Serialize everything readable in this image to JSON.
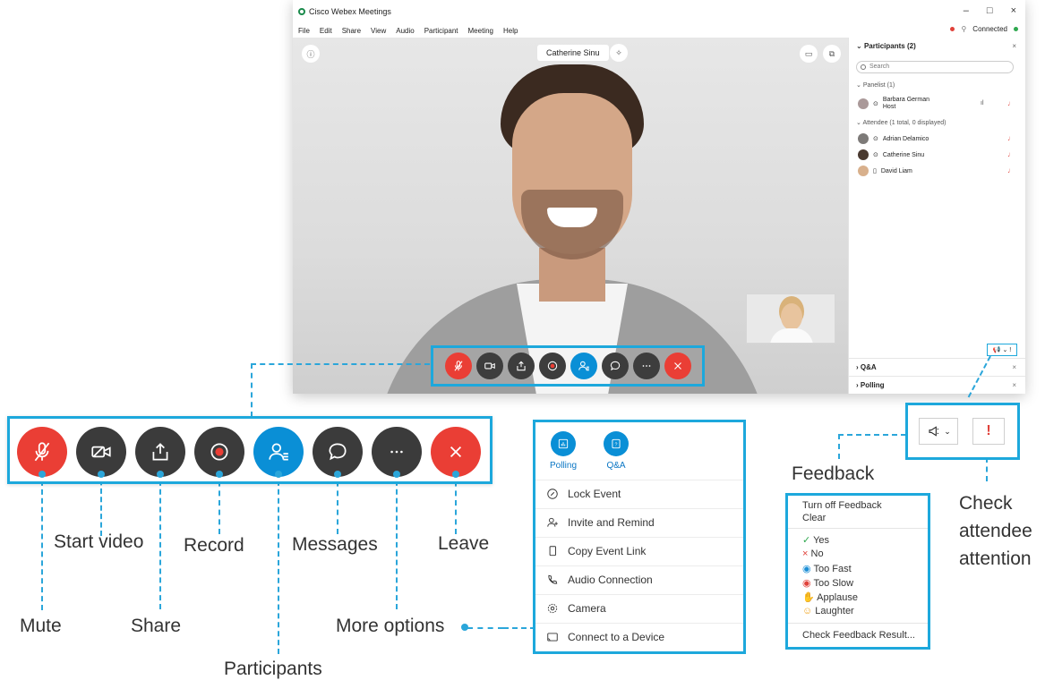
{
  "window": {
    "title": "Cisco Webex Meetings",
    "menu": [
      "File",
      "Edit",
      "Share",
      "View",
      "Audio",
      "Participant",
      "Meeting",
      "Help"
    ],
    "connection_status": "Connected",
    "controls": [
      "–",
      "□",
      "×"
    ]
  },
  "video": {
    "active_speaker": "Catherine Sinu"
  },
  "participants_panel": {
    "header": "Participants (2)",
    "search_placeholder": "Search",
    "panelist_section": "Panelist (1)",
    "panelists": [
      {
        "name": "Barbara German",
        "role": "Host"
      }
    ],
    "attendee_section": "Attendee (1 total, 0 displayed)",
    "attendees": [
      {
        "name": "Adrian Delamico"
      },
      {
        "name": "Catherine Sinu"
      },
      {
        "name": "David Liam"
      }
    ],
    "footer_sections": [
      "Q&A",
      "Polling"
    ]
  },
  "toolbar": {
    "buttons": [
      {
        "id": "mute",
        "icon": "mic-off-icon",
        "color": "#ea3e35"
      },
      {
        "id": "video",
        "icon": "video-off-icon",
        "color": "#3b3b3b"
      },
      {
        "id": "share",
        "icon": "share-icon",
        "color": "#3b3b3b"
      },
      {
        "id": "record",
        "icon": "record-icon",
        "color": "#3b3b3b"
      },
      {
        "id": "participants",
        "icon": "participants-icon",
        "color": "#0a8fd6"
      },
      {
        "id": "messages",
        "icon": "chat-icon",
        "color": "#3b3b3b"
      },
      {
        "id": "more",
        "icon": "more-icon",
        "color": "#3b3b3b"
      },
      {
        "id": "leave",
        "icon": "close-icon",
        "color": "#ea3e35"
      }
    ]
  },
  "callouts": {
    "mute": "Mute",
    "start_video": "Start video",
    "share": "Share",
    "record": "Record",
    "participants": "Participants",
    "messages": "Messages",
    "more_options": "More options",
    "leave": "Leave",
    "feedback": "Feedback",
    "check_attention": [
      "Check",
      "attendee",
      "attention"
    ]
  },
  "more_menu": {
    "top": [
      {
        "label": "Polling",
        "icon": "polling-icon"
      },
      {
        "label": "Q&A",
        "icon": "qa-icon"
      }
    ],
    "items": [
      {
        "label": "Lock Event",
        "icon": "lock-icon"
      },
      {
        "label": "Invite and Remind",
        "icon": "invite-icon"
      },
      {
        "label": "Copy Event Link",
        "icon": "copy-icon"
      },
      {
        "label": "Audio Connection",
        "icon": "phone-icon"
      },
      {
        "label": "Camera",
        "icon": "gear-icon"
      },
      {
        "label": "Connect to a Device",
        "icon": "cast-icon"
      }
    ]
  },
  "feedback_menu": {
    "header": [
      "Turn off Feedback",
      "Clear"
    ],
    "options": [
      {
        "label": "Yes",
        "mark": "✓",
        "color": "#2fa84f"
      },
      {
        "label": "No",
        "mark": "×",
        "color": "#e0413a"
      },
      {
        "label": "Too Fast",
        "mark": "◉",
        "color": "#1d8fd6"
      },
      {
        "label": "Too Slow",
        "mark": "◉",
        "color": "#e0413a"
      },
      {
        "label": "Applause",
        "mark": "✋",
        "color": "#777777"
      },
      {
        "label": "Laughter",
        "mark": "☺",
        "color": "#f0a31c"
      }
    ],
    "footer": "Check Feedback Result..."
  },
  "colors": {
    "accent": "#1da8dc",
    "leave_red": "#ea3e35",
    "active_blue": "#0a8fd6",
    "button_dark": "#3b3b3b"
  }
}
